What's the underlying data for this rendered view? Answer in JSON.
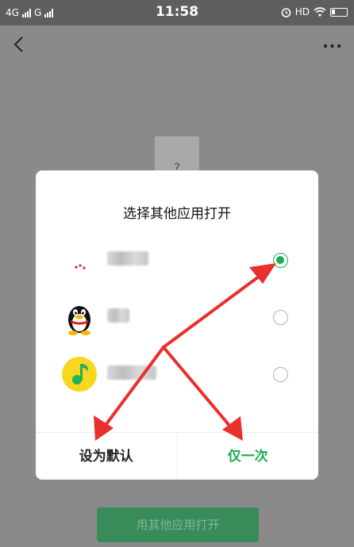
{
  "status_bar": {
    "network_1": "4G",
    "network_2": "G",
    "time": "11:58",
    "hd": "HD",
    "icons": [
      "alarm-icon",
      "wifi-icon",
      "battery-icon"
    ]
  },
  "background": {
    "file_placeholder": "?",
    "open_with_button": "用其他应用打开"
  },
  "dialog": {
    "title": "选择其他应用打开",
    "apps": [
      {
        "icon": "app-icon-red-dots",
        "checked": true
      },
      {
        "icon": "qq-icon",
        "checked": false
      },
      {
        "icon": "qq-music-icon",
        "checked": false
      }
    ],
    "set_default_label": "设为默认",
    "just_once_label": "仅一次"
  },
  "colors": {
    "accent": "#1aad54",
    "arrow": "#e8302c",
    "qq_music_yellow": "#f7d720"
  }
}
